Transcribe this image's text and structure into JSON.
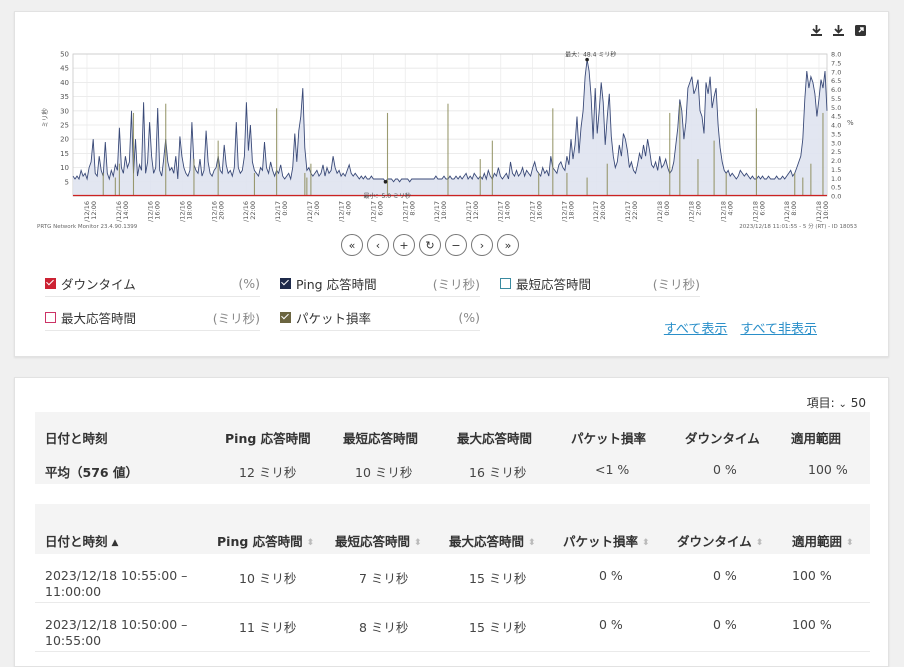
{
  "toolbar": {
    "icons": [
      "download-icon",
      "download-icon",
      "open-external-icon"
    ]
  },
  "chart_data": {
    "type": "line",
    "title": "",
    "ylabel_left": "ミリ秒",
    "ylabel_right": "%",
    "ylim_left": [
      0,
      50
    ],
    "ylim_right": [
      0,
      8
    ],
    "yticks_left": [
      5,
      10,
      15,
      20,
      25,
      30,
      35,
      40,
      45,
      50
    ],
    "yticks_right": [
      "0.0",
      "0.5",
      "1.0",
      "1.5",
      "2.0",
      "2.5",
      "3.0",
      "3.5",
      "4.0",
      "4.5",
      "5.0",
      "5.5",
      "6.0",
      "6.5",
      "7.0",
      "7.5",
      "8.0"
    ],
    "xticks": [
      "/12/16 12:00",
      "/12/16 14:00",
      "/12/16 16:00",
      "/12/16 18:00",
      "/12/16 20:00",
      "/12/16 22:00",
      "/12/17 0:00",
      "/12/17 2:00",
      "/12/17 4:00",
      "/12/17 6:00",
      "/12/17 8:00",
      "/12/17 10:00",
      "/12/17 12:00",
      "/12/17 14:00",
      "/12/17 16:00",
      "/12/17 18:00",
      "/12/17 20:00",
      "/12/17 22:00",
      "/12/18 0:00",
      "/12/18 2:00",
      "/12/18 4:00",
      "/12/18 6:00",
      "/12/18 8:00",
      "/12/18 10:00"
    ],
    "annotation_max": "最大：48.4 ミリ秒",
    "annotation_min": "最小：5.0 ミリ秒",
    "footer_left": "PRTG Network Monitor 23.4.90.1399",
    "footer_right": "2023/12/18 11:01:55 - 5 分 (RT) - ID 18053",
    "series": [
      {
        "name": "Ping 応答時間",
        "color": "#3a4a78",
        "values": [
          7,
          6,
          7,
          6,
          9,
          7,
          8,
          6,
          10,
          12,
          20,
          8,
          7,
          14,
          9,
          7,
          19,
          8,
          6,
          9,
          7,
          11,
          9,
          24,
          10,
          8,
          14,
          10,
          12,
          30,
          8,
          20,
          7,
          11,
          9,
          33,
          8,
          12,
          26,
          14,
          8,
          10,
          31,
          9,
          7,
          13,
          20,
          12,
          9,
          10,
          8,
          14,
          6,
          21,
          14,
          10,
          8,
          7,
          9,
          26,
          11,
          9,
          8,
          13,
          7,
          9,
          23,
          12,
          8,
          7,
          9,
          10,
          14,
          9,
          8,
          18,
          11,
          8,
          9,
          7,
          10,
          26,
          10,
          8,
          9,
          14,
          33,
          16,
          25,
          12,
          9,
          8,
          7,
          10,
          9,
          19,
          10,
          8,
          12,
          9,
          7,
          9,
          8,
          11,
          7,
          6,
          7,
          8,
          6,
          10,
          22,
          12,
          23,
          28,
          38,
          17,
          9,
          10,
          8,
          7,
          8,
          9,
          7,
          8,
          11,
          7,
          10,
          8,
          9,
          14,
          10,
          8,
          9,
          7,
          8,
          7,
          9,
          11,
          8,
          7,
          8,
          7,
          6,
          7,
          6,
          7,
          6,
          6,
          7,
          6,
          6,
          6,
          6,
          6,
          6,
          5,
          6,
          6,
          6,
          5,
          6,
          6,
          5,
          6,
          6,
          6,
          6,
          5,
          6,
          6,
          6,
          6,
          6,
          6,
          6,
          6,
          6,
          6,
          6,
          6,
          7,
          6,
          6,
          6,
          7,
          6,
          6,
          7,
          6,
          6,
          7,
          6,
          7,
          6,
          7,
          8,
          6,
          7,
          6,
          8,
          7,
          6,
          7,
          6,
          8,
          6,
          9,
          7,
          6,
          8,
          7,
          10,
          7,
          6,
          7,
          8,
          6,
          12,
          8,
          7,
          9,
          7,
          8,
          10,
          7,
          9,
          8,
          7,
          10,
          12,
          9,
          8,
          7,
          10,
          8,
          9,
          7,
          14,
          10,
          9,
          8,
          11,
          12,
          10,
          9,
          14,
          11,
          20,
          13,
          18,
          28,
          15,
          24,
          30,
          42,
          48,
          44,
          35,
          20,
          38,
          22,
          30,
          40,
          33,
          18,
          28,
          36,
          21,
          14,
          10,
          12,
          18,
          14,
          22,
          20,
          16,
          10,
          12,
          9,
          8,
          11,
          15,
          13,
          18,
          14,
          20,
          16,
          11,
          10,
          12,
          9,
          14,
          10,
          11,
          13,
          10,
          8,
          9,
          12,
          18,
          24,
          34,
          30,
          20,
          26,
          38,
          40,
          42,
          36,
          38,
          41,
          30,
          28,
          22,
          40,
          36,
          42,
          31,
          35,
          38,
          25,
          17,
          12,
          9,
          8,
          9,
          7,
          8,
          7,
          6,
          7,
          9,
          8,
          7,
          8,
          7,
          6,
          7,
          6,
          6,
          7,
          6,
          7,
          6,
          6,
          7,
          6,
          6,
          6,
          7,
          6,
          6,
          7,
          6,
          7,
          8,
          9,
          7,
          8,
          10,
          12,
          14,
          20,
          34,
          44,
          38,
          42,
          40,
          36,
          28,
          34,
          41,
          38,
          44,
          30
        ]
      },
      {
        "name": "ダウンタイム",
        "color": "#cc2222",
        "values": "0"
      },
      {
        "name": "パケット損率",
        "color": "#8a8a58",
        "values": "spikes"
      }
    ]
  },
  "nav": [
    "«",
    "‹",
    "+",
    "↻",
    "−",
    "›",
    "»"
  ],
  "legend": [
    {
      "label": "ダウンタイム",
      "unit": "(%)",
      "color": "#cc2233",
      "checked": true
    },
    {
      "label": "Ping 応答時間",
      "unit": "(ミリ秒)",
      "color": "#1e2a4a",
      "checked": true
    },
    {
      "label": "最短応答時間",
      "unit": "(ミリ秒)",
      "color": "#3a8aa0",
      "checked": false
    },
    {
      "label": "最大応答時間",
      "unit": "(ミリ秒)",
      "color": "#cc3366",
      "checked": false
    },
    {
      "label": "パケット損率",
      "unit": "(%)",
      "color": "#6b6540",
      "checked": true
    }
  ],
  "links": {
    "show_all": "すべて表示",
    "hide_all": "すべて非表示"
  },
  "table": {
    "items_label": "項目:",
    "items_value": "50",
    "headers": [
      "日付と時刻",
      "Ping 応答時間",
      "最短応答時間",
      "最大応答時間",
      "パケット損率",
      "ダウンタイム",
      "適用範囲"
    ],
    "summary": [
      "平均（576 値）",
      "12 ミリ秒",
      "10 ミリ秒",
      "16 ミリ秒",
      "<1 %",
      "0 %",
      "100 %"
    ],
    "rows": [
      {
        "date1": "2023/12/18 10:55:00 –",
        "date2": "11:00:00",
        "ping": "10 ミリ秒",
        "min": "7 ミリ秒",
        "max": "15 ミリ秒",
        "loss": "0 %",
        "down": "0 %",
        "coverage": "100 %"
      },
      {
        "date1": "2023/12/18 10:50:00 –",
        "date2": "10:55:00",
        "ping": "11 ミリ秒",
        "min": "8 ミリ秒",
        "max": "15 ミリ秒",
        "loss": "0 %",
        "down": "0 %",
        "coverage": "100 %"
      }
    ]
  }
}
